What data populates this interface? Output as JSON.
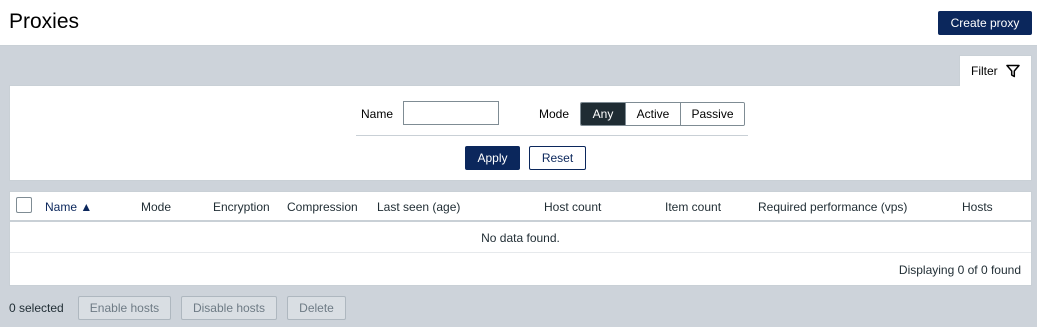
{
  "header": {
    "title": "Proxies",
    "create_button": "Create proxy"
  },
  "filter": {
    "tab_label": "Filter",
    "name_label": "Name",
    "name_value": "",
    "mode_label": "Mode",
    "mode_options": [
      "Any",
      "Active",
      "Passive"
    ],
    "mode_selected": "Any",
    "apply_label": "Apply",
    "reset_label": "Reset"
  },
  "table": {
    "columns": [
      "Name ▲",
      "Mode",
      "Encryption",
      "Compression",
      "Last seen (age)",
      "Host count",
      "Item count",
      "Required performance (vps)",
      "Hosts"
    ],
    "empty_message": "No data found.",
    "display_count": "Displaying 0 of 0 found"
  },
  "footer": {
    "selected_count": "0 selected",
    "enable_hosts": "Enable hosts",
    "disable_hosts": "Disable hosts",
    "delete": "Delete"
  },
  "colors": {
    "primary": "#0b275c",
    "background": "#cdd3da",
    "selected_segment": "#1f2c33"
  }
}
